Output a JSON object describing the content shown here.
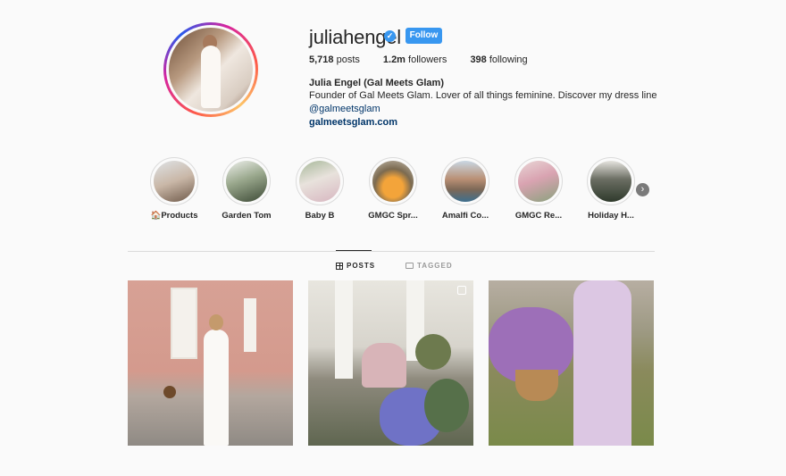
{
  "profile": {
    "username": "juliahengel",
    "follow_label": "Follow",
    "verified_icon": "verified-badge-icon",
    "stats": {
      "posts_count": "5,718",
      "posts_label": "posts",
      "followers_count": "1.2m",
      "followers_label": "followers",
      "following_count": "398",
      "following_label": "following"
    },
    "bio": {
      "name": "Julia Engel (Gal Meets Glam)",
      "text": "Founder of Gal Meets Glam. Lover of all things feminine. Discover my dress line",
      "mention": "@galmeetsglam",
      "link": "galmeetsglam.com"
    }
  },
  "highlights": [
    {
      "label": "🏠Products"
    },
    {
      "label": "Garden Tom"
    },
    {
      "label": "Baby B"
    },
    {
      "label": "GMGC Spr..."
    },
    {
      "label": "Amalfi Co..."
    },
    {
      "label": "GMGC Re..."
    },
    {
      "label": "Holiday H..."
    }
  ],
  "tabs": {
    "posts_label": "POSTS",
    "tagged_label": "TAGGED"
  },
  "colors": {
    "accent": "#3897f0",
    "link": "#003569",
    "text": "#262626",
    "background": "#fafafa"
  }
}
